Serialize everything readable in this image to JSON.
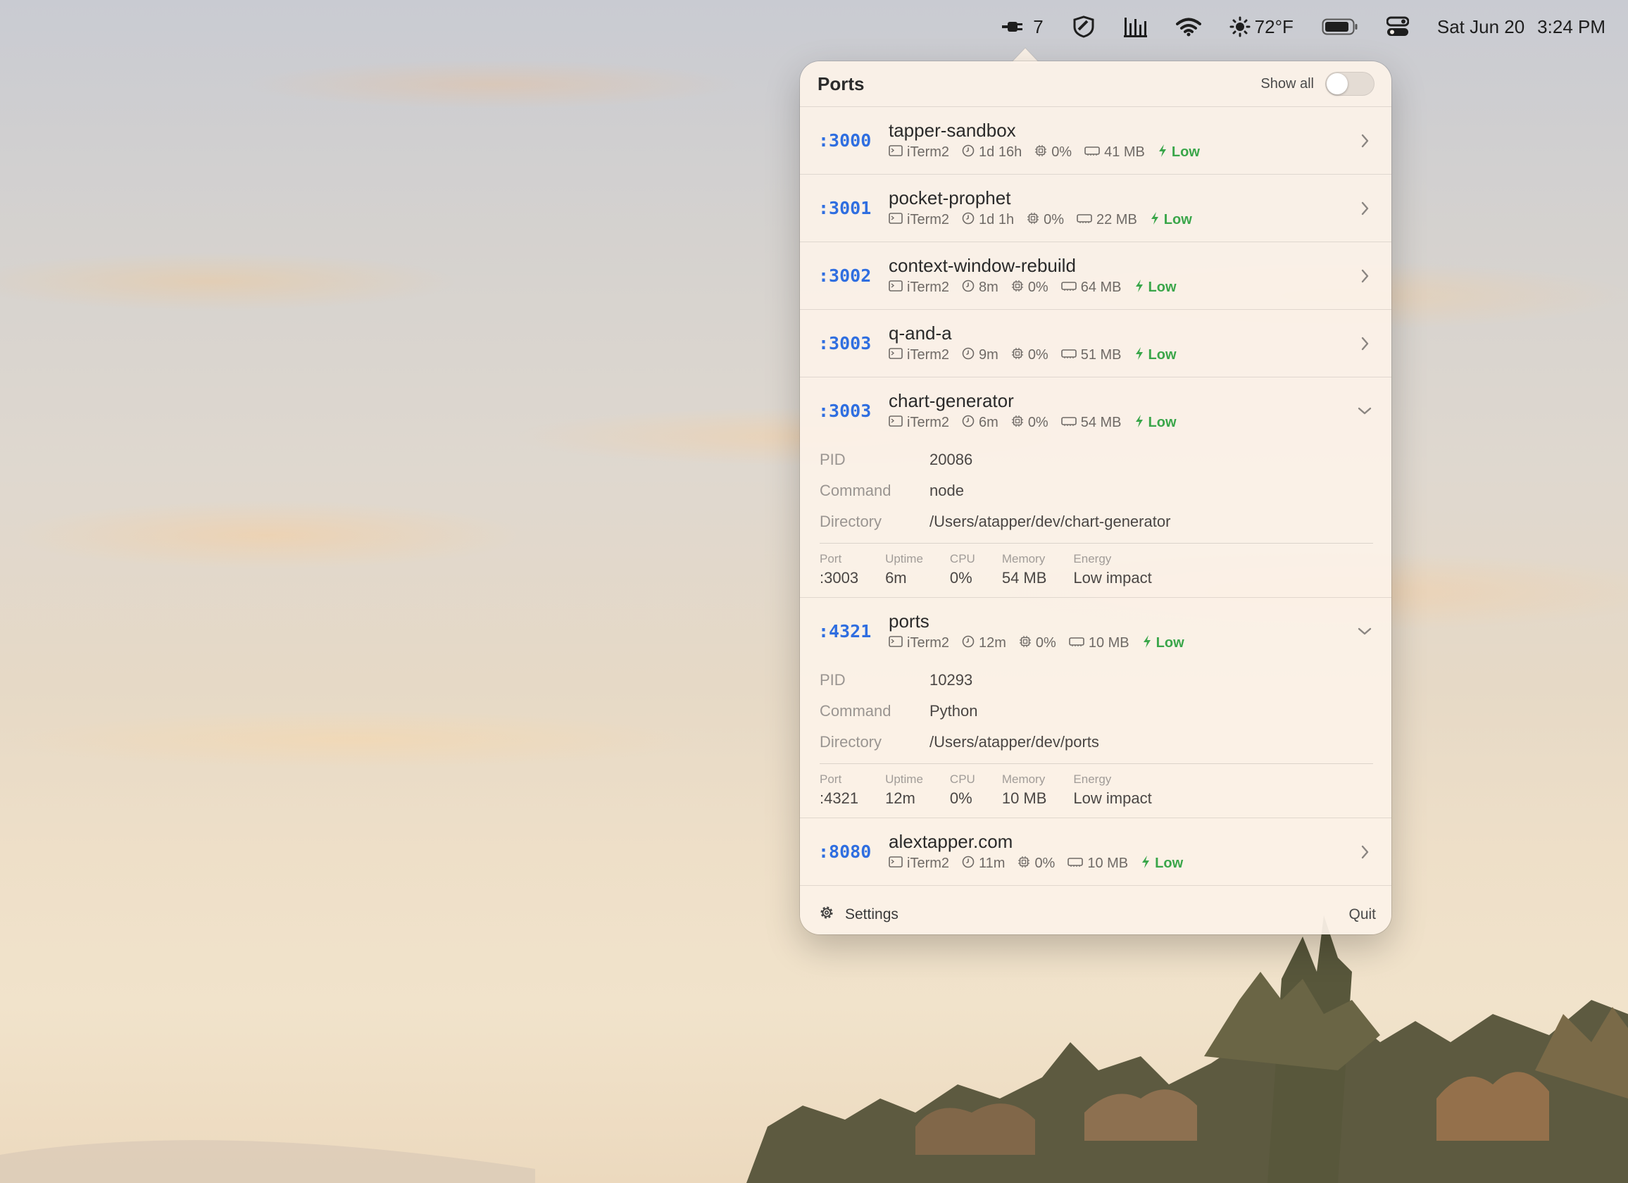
{
  "menubar": {
    "ports_count": "7",
    "weather": "72°F",
    "date": "Sat Jun 20",
    "time": "3:24 PM",
    "icons": [
      "plug-icon",
      "shield-pen-icon",
      "audio-levels-icon",
      "wifi-icon",
      "sun-icon",
      "battery-icon",
      "control-center-icon"
    ]
  },
  "panel": {
    "title": "Ports",
    "show_all_label": "Show all",
    "show_all_on": false,
    "rows": [
      {
        "port": ":3000",
        "name": "tapper-sandbox",
        "app": "iTerm2",
        "uptime": "1d 16h",
        "cpu": "0%",
        "memory": "41 MB",
        "energy": "Low",
        "expanded": false
      },
      {
        "port": ":3001",
        "name": "pocket-prophet",
        "app": "iTerm2",
        "uptime": "1d 1h",
        "cpu": "0%",
        "memory": "22 MB",
        "energy": "Low",
        "expanded": false
      },
      {
        "port": ":3002",
        "name": "context-window-rebuild",
        "app": "iTerm2",
        "uptime": "8m",
        "cpu": "0%",
        "memory": "64 MB",
        "energy": "Low",
        "expanded": false
      },
      {
        "port": ":3003",
        "name": "q-and-a",
        "app": "iTerm2",
        "uptime": "9m",
        "cpu": "0%",
        "memory": "51 MB",
        "energy": "Low",
        "expanded": false
      },
      {
        "port": ":3003",
        "name": "chart-generator",
        "app": "iTerm2",
        "uptime": "6m",
        "cpu": "0%",
        "memory": "54 MB",
        "energy": "Low",
        "expanded": true,
        "details": {
          "pid_label": "PID",
          "pid": "20086",
          "command_label": "Command",
          "command": "node",
          "directory_label": "Directory",
          "directory": "/Users/atapper/dev/chart-generator",
          "stats": [
            {
              "label": "Port",
              "value": ":3003"
            },
            {
              "label": "Uptime",
              "value": "6m"
            },
            {
              "label": "CPU",
              "value": "0%"
            },
            {
              "label": "Memory",
              "value": "54 MB"
            },
            {
              "label": "Energy",
              "value": "Low impact"
            }
          ]
        }
      },
      {
        "port": ":4321",
        "name": "ports",
        "app": "iTerm2",
        "uptime": "12m",
        "cpu": "0%",
        "memory": "10 MB",
        "energy": "Low",
        "expanded": true,
        "details": {
          "pid_label": "PID",
          "pid": "10293",
          "command_label": "Command",
          "command": "Python",
          "directory_label": "Directory",
          "directory": "/Users/atapper/dev/ports",
          "stats": [
            {
              "label": "Port",
              "value": ":4321"
            },
            {
              "label": "Uptime",
              "value": "12m"
            },
            {
              "label": "CPU",
              "value": "0%"
            },
            {
              "label": "Memory",
              "value": "10 MB"
            },
            {
              "label": "Energy",
              "value": "Low impact"
            }
          ]
        }
      },
      {
        "port": ":8080",
        "name": "alextapper.com",
        "app": "iTerm2",
        "uptime": "11m",
        "cpu": "0%",
        "memory": "10 MB",
        "energy": "Low",
        "expanded": false
      }
    ],
    "footer": {
      "settings_label": "Settings",
      "quit_label": "Quit"
    }
  },
  "colors": {
    "port": "#2f6ee0",
    "energy": "#3aa64a"
  }
}
